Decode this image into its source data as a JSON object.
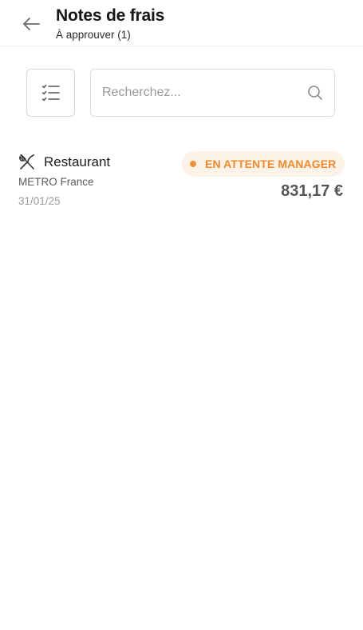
{
  "header": {
    "title": "Notes de frais",
    "subtitle": "À approuver (1)",
    "back_icon": "arrow-left-icon"
  },
  "toolbar": {
    "filter_icon": "checklist-filter-icon",
    "search": {
      "placeholder": "Recherchez...",
      "value": "",
      "icon": "search-icon"
    }
  },
  "expenses": [
    {
      "category": "Restaurant",
      "category_icon": "fork-knife-icon",
      "merchant": "METRO France",
      "date": "31/01/25",
      "status": "EN ATTENTE MANAGER",
      "status_color": "#ef8a2e",
      "amount": "831,17 €"
    }
  ]
}
